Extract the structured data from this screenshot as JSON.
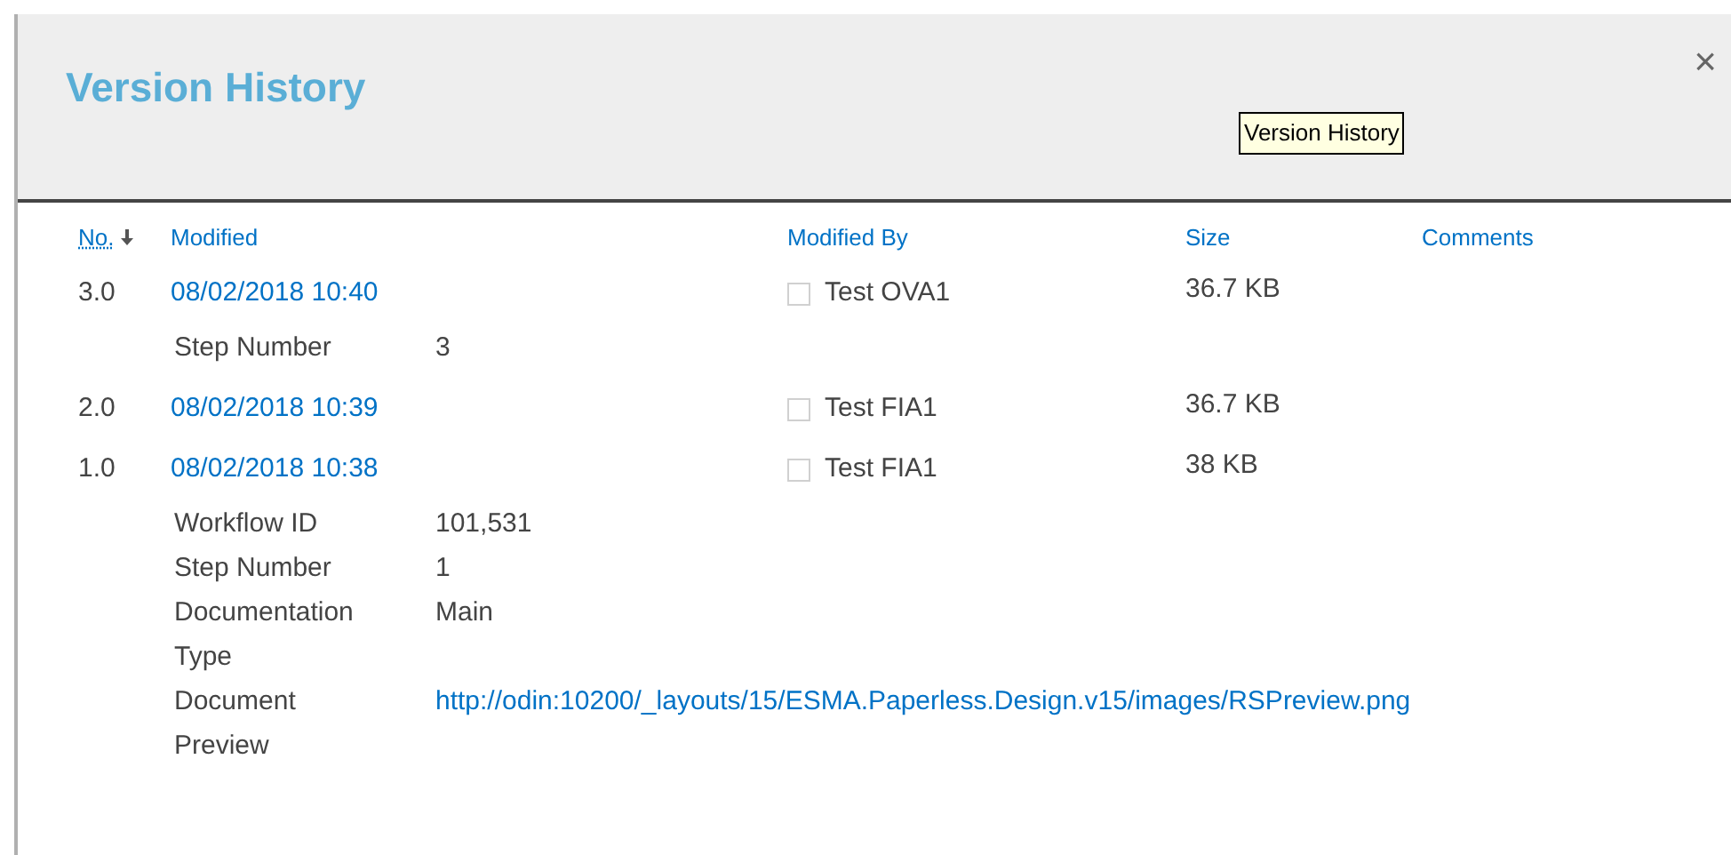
{
  "dialog": {
    "title": "Version History",
    "close": "×",
    "tooltip": "Version History"
  },
  "table": {
    "columns": [
      {
        "label": "No.",
        "sorted": true
      },
      {
        "label": "Modified",
        "sorted": false
      },
      {
        "label": "Modified By",
        "sorted": false
      },
      {
        "label": "Size",
        "sorted": false
      },
      {
        "label": "Comments",
        "sorted": false
      }
    ],
    "rows": [
      {
        "no": "3.0",
        "modified": "08/02/2018 10:40",
        "modified_by": "Test OVA1",
        "size": "36.7 KB",
        "details": [
          {
            "label": "Step Number",
            "value": "3",
            "kind": "text"
          }
        ]
      },
      {
        "no": "2.0",
        "modified": "08/02/2018 10:39",
        "modified_by": "Test FIA1",
        "size": "36.7 KB",
        "details": []
      },
      {
        "no": "1.0",
        "modified": "08/02/2018 10:38",
        "modified_by": "Test FIA1",
        "size": "38 KB",
        "details": [
          {
            "label": "Workflow ID",
            "value": "101,531",
            "kind": "text"
          },
          {
            "label": "Step Number",
            "value": "1",
            "kind": "text"
          },
          {
            "label": "Documentation Type",
            "value": "Main",
            "kind": "text"
          },
          {
            "label": "Document Preview",
            "value": "http://odin:10200/_layouts/15/ESMA.Paperless.Design.v15/images/RSPreview.png",
            "kind": "link"
          }
        ]
      }
    ]
  }
}
